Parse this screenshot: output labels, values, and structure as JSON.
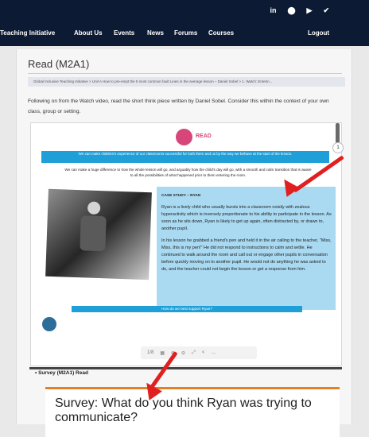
{
  "colors": {
    "topbar": "#0d1a33",
    "accent_pink": "#d6467a",
    "accent_blue": "#1e9fd8",
    "case_bg": "#a9daf2",
    "survey_orange": "#e67e22",
    "arrow": "#e02020"
  },
  "social": [
    "in",
    "⬤",
    "▶",
    "✔"
  ],
  "nav": {
    "items": [
      "Teaching Initiative",
      "About Us",
      "Events",
      "News",
      "Forums",
      "Courses",
      "Logout"
    ]
  },
  "page": {
    "title": "Read (M2A1)",
    "breadcrumb": "Global Inclusive Teaching Initiative > Unit A How to pre-empt the 5 most common fault Lines in the average lesson – Daniel Sobel > 1. Watch: Enterin...",
    "intro": "Following on from the Watch video, read the short think piece written by Daniel Sobel. Consider this within the context of your own class, group or setting."
  },
  "reader": {
    "read_label": "READ",
    "banner": "We can make children's experience of our classrooms successful for both them and us by the way we behave at the start of the lesson.",
    "paragraph": "We can make a huge difference to how the whole lesson will go, and arguably how the child's day will go, with a smooth and calm transition that is aware to all the possibilities of what happened prior to them entering the room.",
    "case_title": "CASE STUDY – RYAN",
    "case_p1": "Ryan is a lively child who usually bursts into a classroom noisily with zealous hyperactivity which is inversely proportionate to his ability to participate in the lesson. As soon as he sits down, Ryan is likely to get up again, often distracted by, or drawn to, another pupil.",
    "case_p2": "In his lesson he grabbed a friend's pen and held it in the air calling to the teacher, \"Miss, Miss, this is my pen!\" He did not respond to instructions to calm and settle. He continued to walk around the room and call out or engage other pupils in conversation before quickly moving on to another pupil. He would not do anything he was asked to do, and the teacher could not begin the lesson or get a response from him.",
    "question": "How do we best support Ryan?",
    "page_number": "1",
    "page_of": "1/8",
    "toolbar_icons": [
      "grid-icon",
      "zoom-in-icon",
      "zoom-out-icon",
      "fullscreen-icon",
      "share-icon",
      "more-icon"
    ]
  },
  "survey": {
    "list_item": "Survey (M2A1) Read",
    "card_title": "Survey: What do you think Ryan was trying to communicate?"
  }
}
